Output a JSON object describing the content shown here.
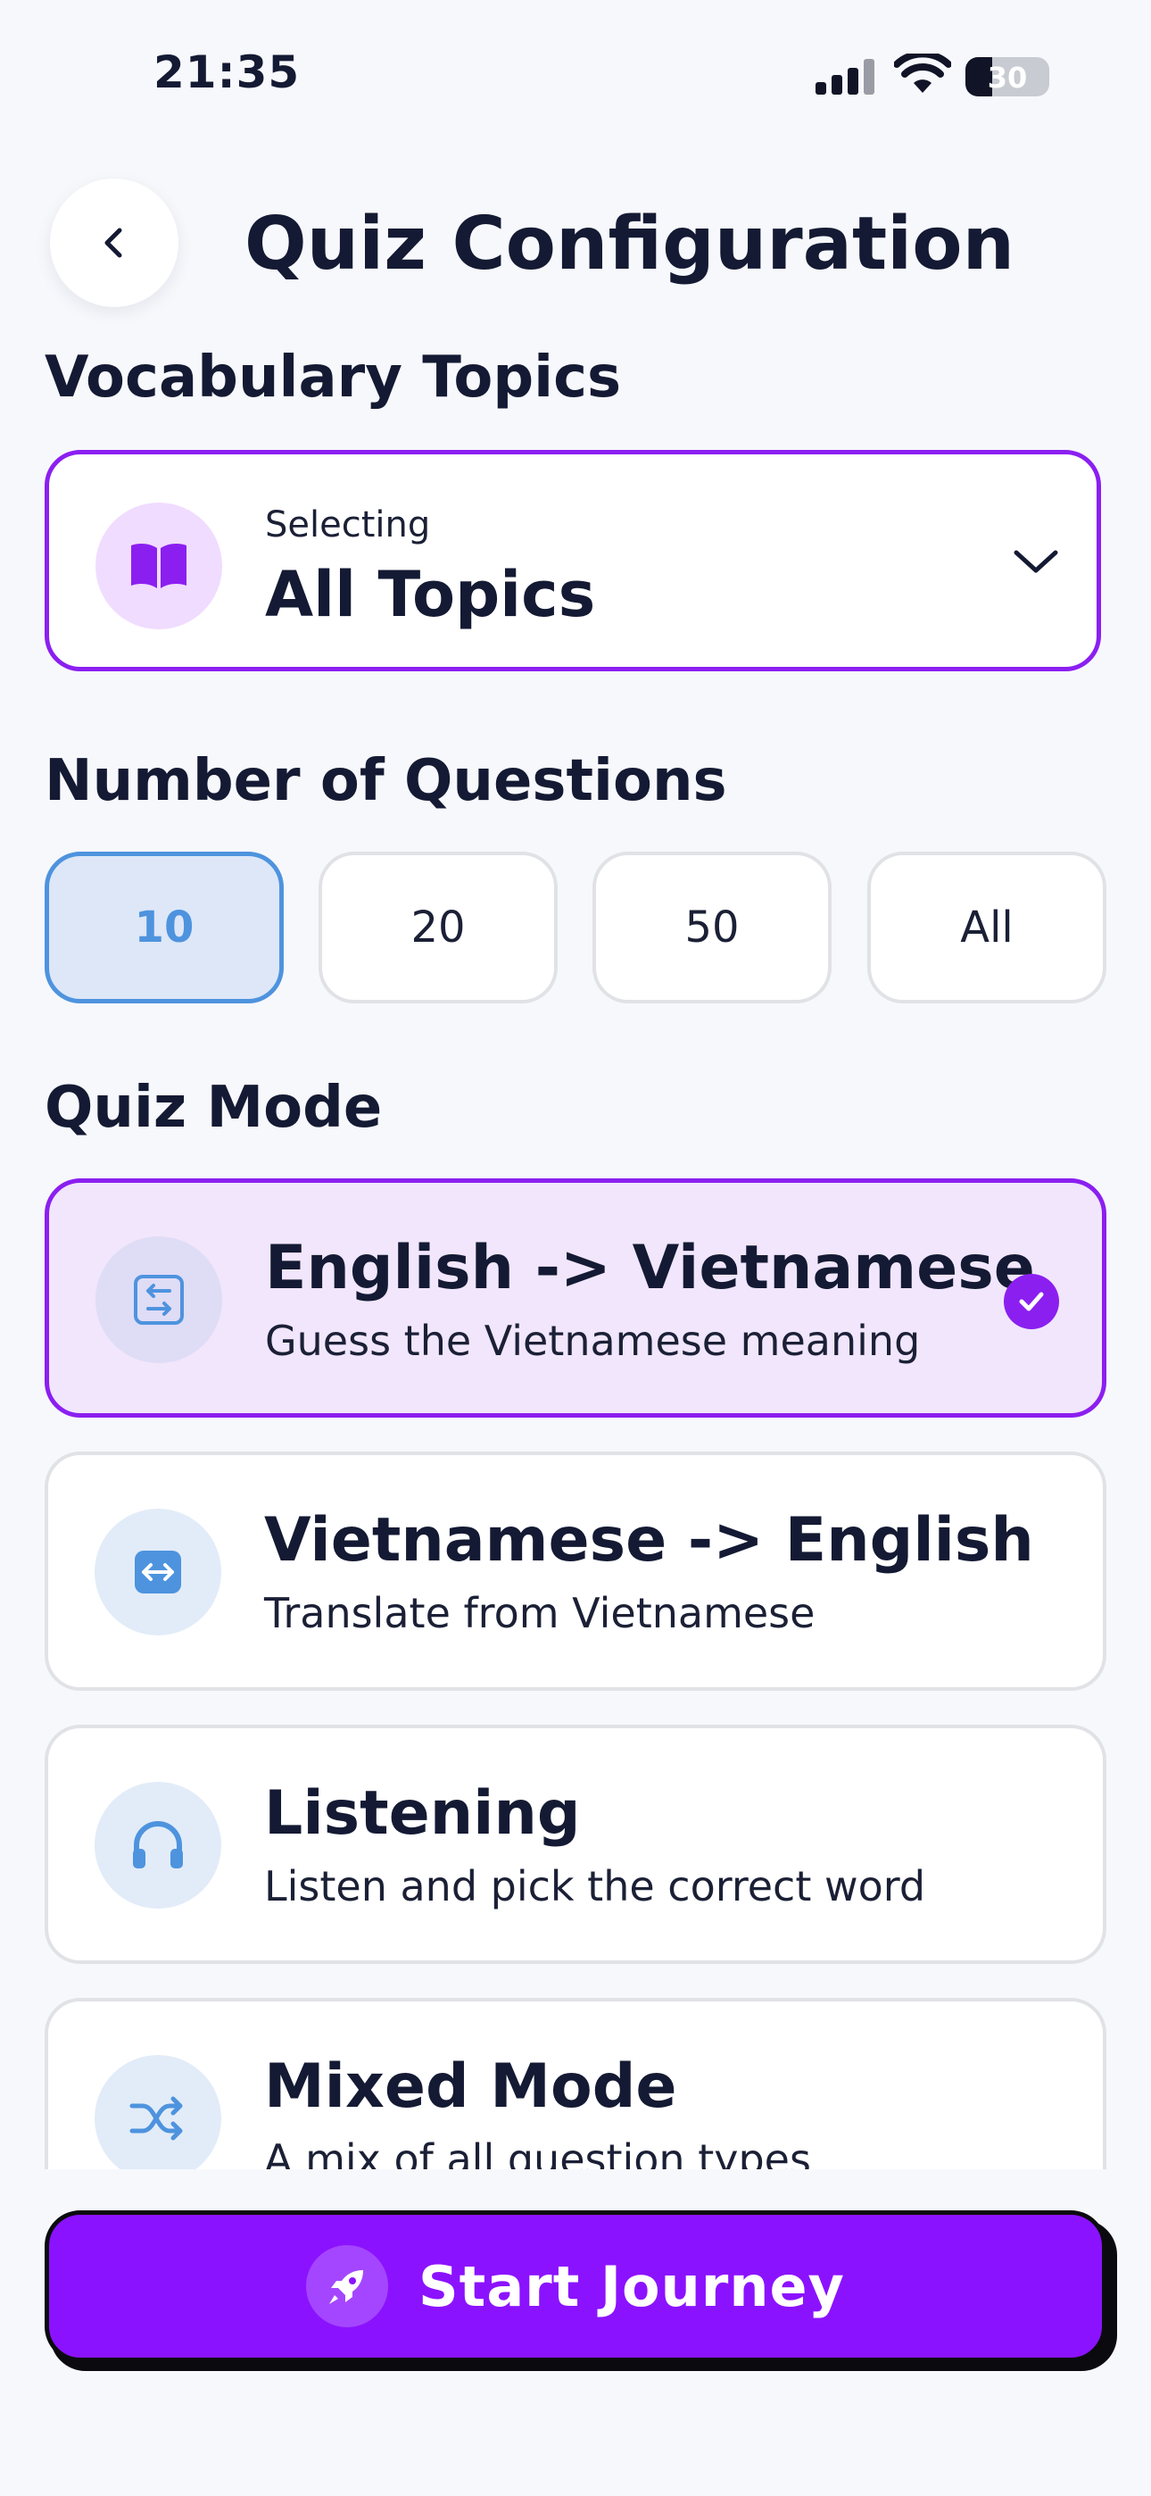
{
  "status_bar": {
    "time": "21:35",
    "battery": "30"
  },
  "header": {
    "title": "Quiz Configuration",
    "back_icon": "chevron-left-icon"
  },
  "topics": {
    "section_label": "Vocabulary Topics",
    "dropdown": {
      "caption": "Selecting",
      "value": "All Topics",
      "icon": "book-icon"
    }
  },
  "questions": {
    "section_label": "Number of Questions",
    "options": [
      "10",
      "20",
      "50",
      "All"
    ],
    "selected": "10"
  },
  "mode": {
    "section_label": "Quiz Mode",
    "options": [
      {
        "title": "English -> Vietnamese",
        "description": "Guess the Vietnamese meaning",
        "icon": "translate-icon",
        "selected": true
      },
      {
        "title": "Vietnamese -> English",
        "description": "Translate from Vietnamese",
        "icon": "swap-arrows-icon",
        "selected": false
      },
      {
        "title": "Listening",
        "description": "Listen and pick the correct word",
        "icon": "headphones-icon",
        "selected": false
      },
      {
        "title": "Mixed Mode",
        "description": "A mix of all question types",
        "icon": "shuffle-icon",
        "selected": false
      }
    ]
  },
  "cta": {
    "label": "Start Journey",
    "icon": "rocket-icon"
  },
  "colors": {
    "accent": "#8b12ff",
    "selected_pill": "#4e93de",
    "background": "#f7f8fc"
  }
}
